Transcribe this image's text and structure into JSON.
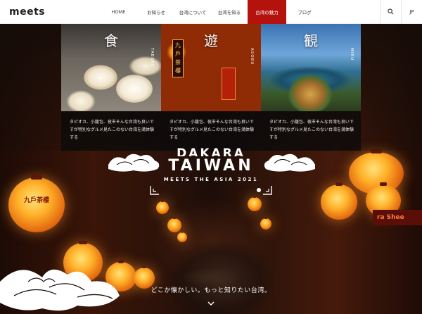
{
  "header": {
    "logo": "meets",
    "nav": [
      {
        "label": "HOME",
        "active": false
      },
      {
        "label": "お知らせ",
        "active": false
      },
      {
        "label": "台湾について",
        "active": false
      },
      {
        "label": "台湾を知る",
        "active": false
      },
      {
        "label": "台湾の魅力",
        "active": true
      },
      {
        "label": "ブログ",
        "active": false
      }
    ],
    "search_icon": "search-icon",
    "lang": "JP",
    "accent": "#b3120d"
  },
  "cards": [
    {
      "kanji": "食",
      "romaji": "TABERU",
      "text": "タピオカ、小籠包、夜市そんな台湾も良いですが特別なグルメ見たこのない台湾を満体験する"
    },
    {
      "kanji": "遊",
      "romaji": "ASOBU",
      "text": "タピオカ、小籠包、夜市そんな台湾も良いですが特別なグルメ見たこのない台湾を満体験する"
    },
    {
      "kanji": "観",
      "romaji": "MIRU",
      "text": "タピオカ、小籠包、夜市そんな台湾も良いですが特別なグルメ見たこのない台湾を満体験する"
    }
  ],
  "hero": {
    "title_top": "DAKARA",
    "title": "TAIWAN",
    "subtitle": "MEETS THE ASIA 2021",
    "tagline": "どこか懐かしい。もっと知りたい台湾。",
    "lantern_glyph": "九戶茶樓",
    "sign_text": "ra Shee"
  }
}
